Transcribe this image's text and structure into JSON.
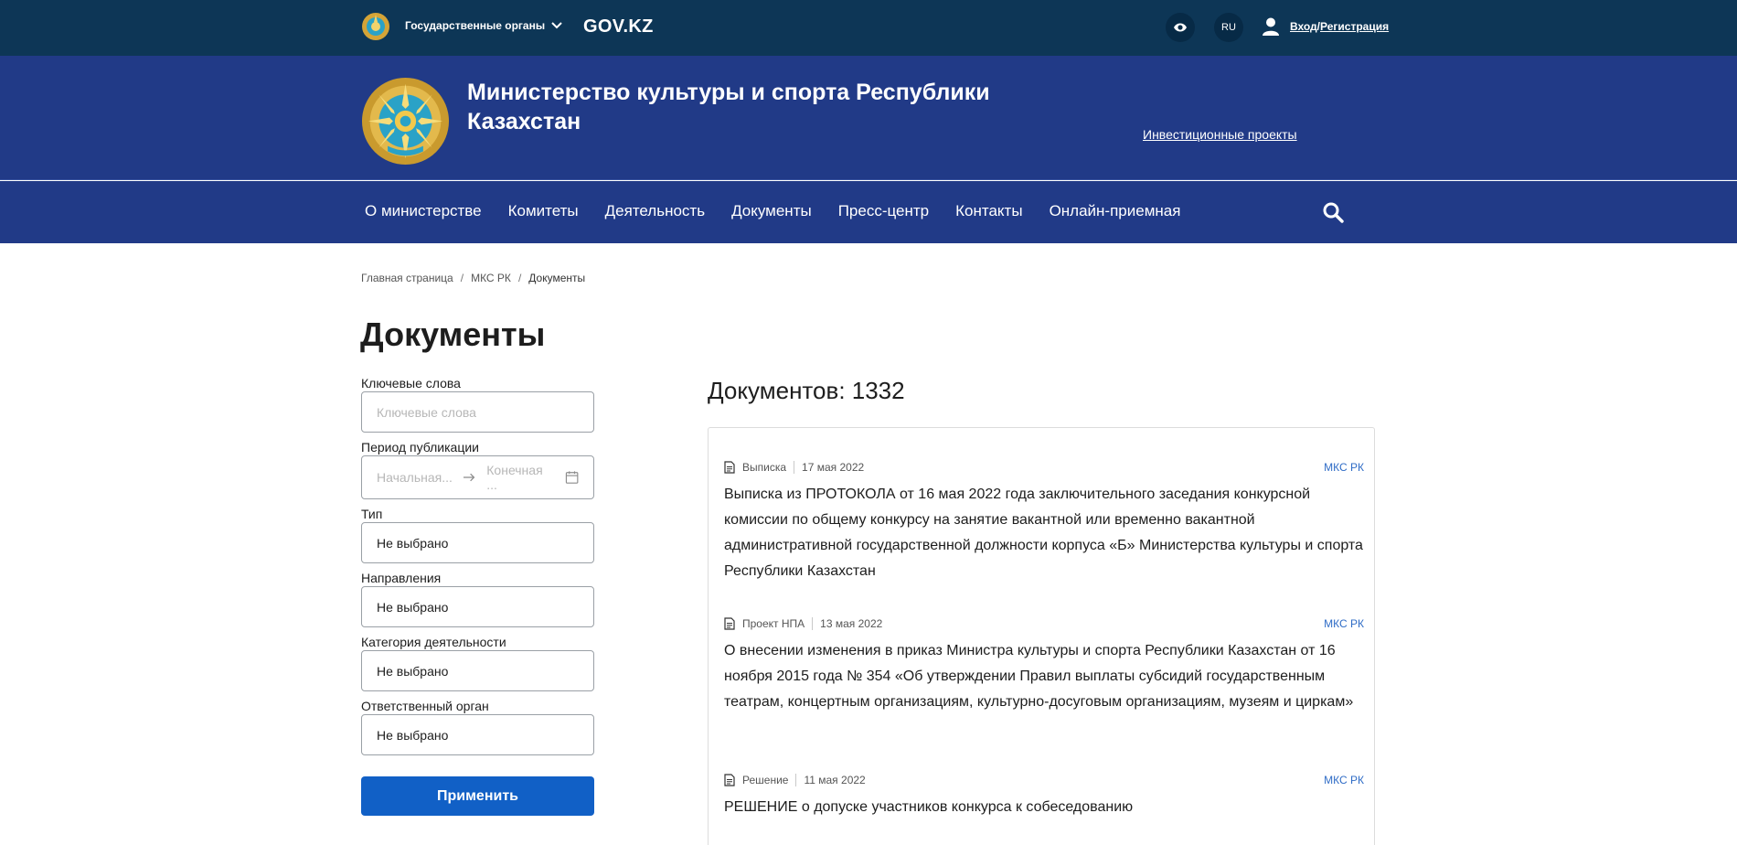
{
  "topbar": {
    "gov_organs": "Государственные органы",
    "gov_kz": "GOV.KZ",
    "lang": "RU",
    "login": "Вход",
    "login_sep": "/",
    "register": "Регистрация"
  },
  "header": {
    "title": "Министерство культуры и спорта Республики Казахстан",
    "invest_link": "Инвестиционные проекты"
  },
  "nav": {
    "items": [
      "О министерстве",
      "Комитеты",
      "Деятельность",
      "Документы",
      "Пресс-центр",
      "Контакты",
      "Онлайн-приемная"
    ]
  },
  "breadcrumb": {
    "items": [
      "Главная страница",
      "МКС РК",
      "Документы"
    ],
    "separator": "/"
  },
  "page_title": "Документы",
  "filters": {
    "keywords_label": "Ключевые слова",
    "keywords_placeholder": "Ключевые слова",
    "period_label": "Период публикации",
    "period_start_placeholder": "Начальная...",
    "period_end_placeholder": "Конечная ...",
    "type_label": "Тип",
    "type_value": "Не выбрано",
    "directions_label": "Направления",
    "directions_value": "Не выбрано",
    "category_label": "Категория деятельности",
    "category_value": "Не выбрано",
    "responsible_label": "Ответственный орган",
    "responsible_value": "Не выбрано",
    "apply_label": "Применить"
  },
  "results": {
    "count_label": "Документов: 1332",
    "documents": [
      {
        "type": "Выписка",
        "date": "17 мая 2022",
        "org": "МКС РК",
        "title": "Выписка из ПРОТОКОЛА от 16 мая 2022 года заключительного заседания конкурсной комиссии по общему конкурсу на занятие вакантной или временно вакантной административной государственной должности корпуса «Б» Министерства культуры и спорта Республики Казахстан"
      },
      {
        "type": "Проект НПА",
        "date": "13 мая 2022",
        "org": "МКС РК",
        "title": "О внесении изменения в приказ Министра культуры и спорта Республики Казахстан от 16 ноября 2015 года № 354 «Об утверждении Правил выплаты субсидий государственным театрам, концертным организациям, культурно-досуговым организациям, музеям и циркам»"
      },
      {
        "type": "Решение",
        "date": "11 мая 2022",
        "org": "МКС РК",
        "title": "РЕШЕНИЕ о допуске участников конкурса к собеседованию"
      }
    ]
  },
  "colors": {
    "topbar_bg": "#0d3656",
    "header_bg": "#213a87",
    "primary_button": "#1160c6",
    "link_blue": "#2f6cc6"
  }
}
